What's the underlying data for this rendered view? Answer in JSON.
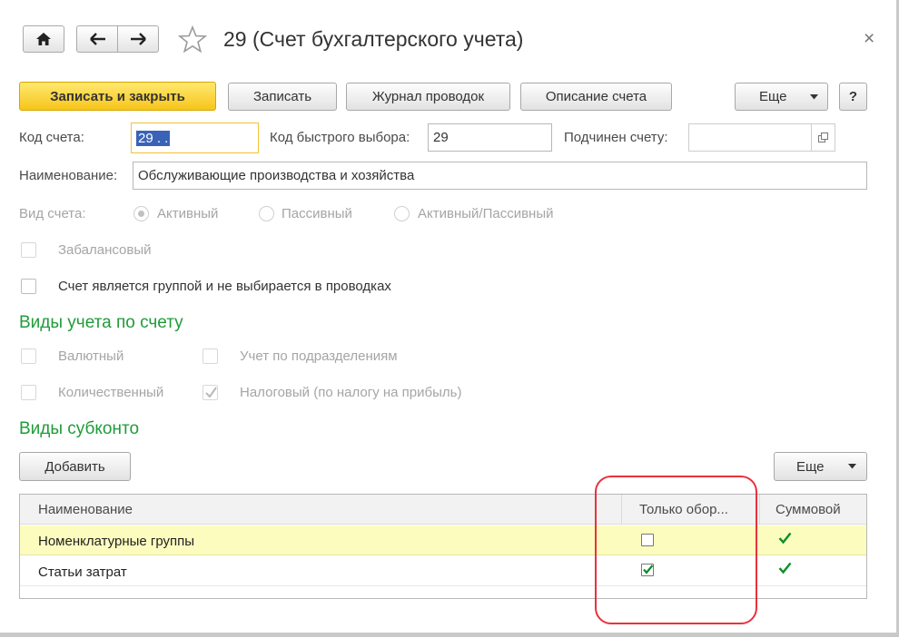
{
  "window": {
    "title": "29 (Счет бухгалтерского учета)",
    "close_glyph": "×"
  },
  "nav": {
    "home_glyph": "⌂",
    "back_glyph": "←",
    "forward_glyph": "→",
    "favorite_glyph": "☆"
  },
  "toolbar": {
    "save_close_label": "Записать и закрыть",
    "save_label": "Записать",
    "journal_label": "Журнал проводок",
    "description_label": "Описание счета",
    "more_label": "Еще",
    "help_label": "?"
  },
  "form": {
    "code_label": "Код счета:",
    "code_value": "29 .  .",
    "quick_code_label": "Код быстрого выбора:",
    "quick_code_value": "29",
    "parent_label": "Подчинен счету:",
    "parent_value": "",
    "name_label": "Наименование:",
    "name_value": "Обслуживающие производства и хозяйства",
    "type_label": "Вид счета:",
    "type_options": [
      "Активный",
      "Пассивный",
      "Активный/Пассивный"
    ],
    "type_selected": "Активный",
    "offbalance_label": "Забалансовый",
    "offbalance_checked": false,
    "group_label": "Счет является группой и не выбирается в проводках",
    "group_checked": false
  },
  "accounting_types": {
    "title": "Виды учета по счету",
    "currency_label": "Валютный",
    "currency_checked": false,
    "quantity_label": "Количественный",
    "quantity_checked": false,
    "divisions_label": "Учет по подразделениям",
    "divisions_checked": false,
    "tax_label": "Налоговый (по налогу на прибыль)",
    "tax_checked": true
  },
  "subconto": {
    "title": "Виды субконто",
    "add_label": "Добавить",
    "more_label": "Еще",
    "columns": [
      "Наименование",
      "Только обор...",
      "Суммовой"
    ],
    "rows": [
      {
        "name": "Номенклатурные группы",
        "turnover_only": false,
        "sum": true
      },
      {
        "name": "Статьи затрат",
        "turnover_only": true,
        "sum": true
      }
    ]
  },
  "colors": {
    "accent_green": "#1f9c3a",
    "primary_button": "#f7c51b",
    "selected_row": "#fcfcbf",
    "highlight_annotation": "#e8323c"
  }
}
